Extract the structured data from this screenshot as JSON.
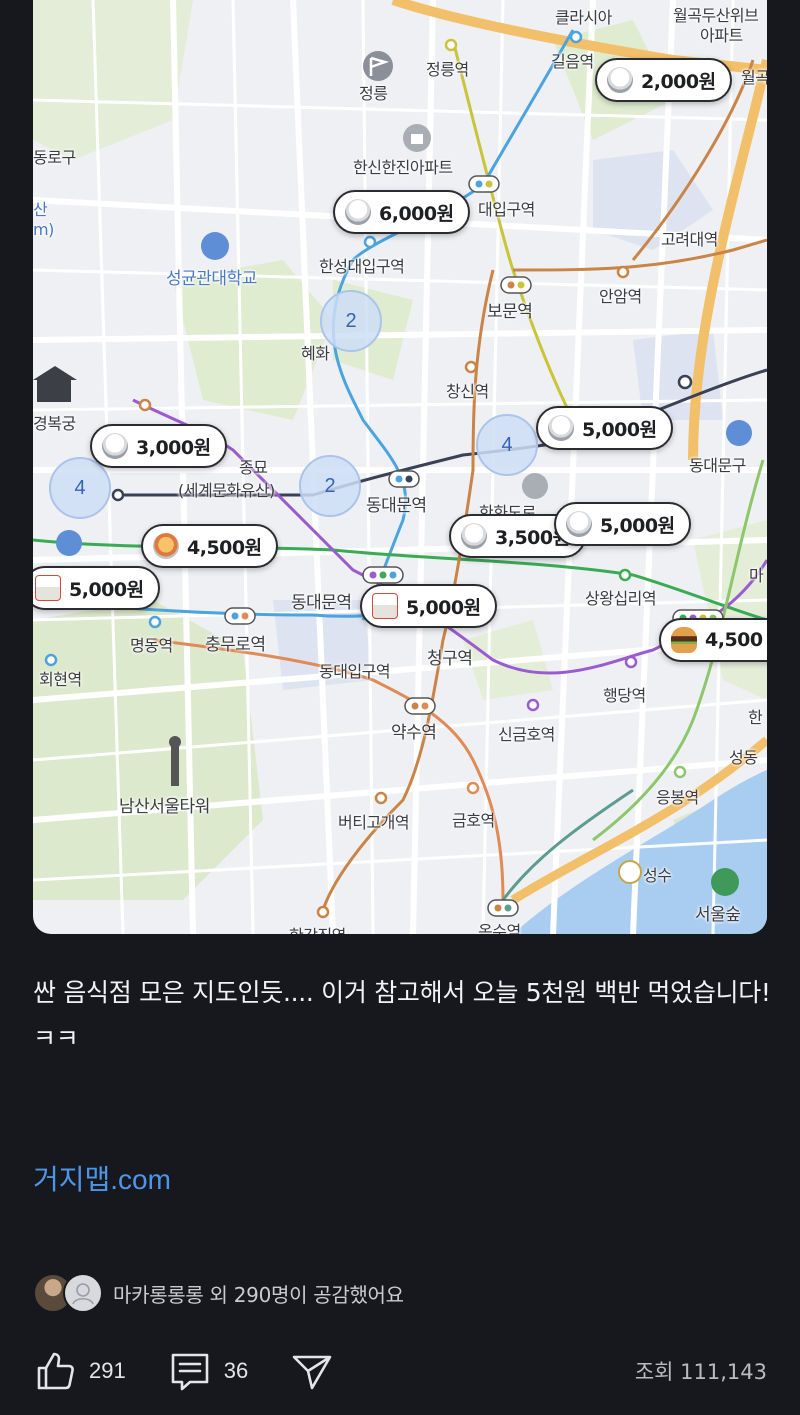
{
  "map": {
    "labels": [
      {
        "text": "클라시아",
        "cls": ""
      },
      {
        "text": "월곡두산위브",
        "cls": ""
      },
      {
        "text": "아파트",
        "cls": ""
      },
      {
        "text": "정릉역",
        "cls": ""
      },
      {
        "text": "길음역",
        "cls": ""
      },
      {
        "text": "월곡",
        "cls": ""
      },
      {
        "text": "정릉",
        "cls": ""
      },
      {
        "text": "동로구",
        "cls": ""
      },
      {
        "text": "한신한진아파트",
        "cls": ""
      },
      {
        "text": "대입구역",
        "cls": ""
      },
      {
        "text": "산",
        "cls": "blue"
      },
      {
        "text": "m)",
        "cls": "blue"
      },
      {
        "text": "고려대역",
        "cls": ""
      },
      {
        "text": "성균관대학교",
        "cls": "blue"
      },
      {
        "text": "한성대입구역",
        "cls": ""
      },
      {
        "text": "안암역",
        "cls": ""
      },
      {
        "text": "보문역",
        "cls": ""
      },
      {
        "text": "혜화",
        "cls": ""
      },
      {
        "text": "창신역",
        "cls": ""
      },
      {
        "text": "경복궁",
        "cls": ""
      },
      {
        "text": "동대문구",
        "cls": ""
      },
      {
        "text": "종묘",
        "cls": ""
      },
      {
        "text": "(세계문화유산)",
        "cls": ""
      },
      {
        "text": "동대문역",
        "cls": ""
      },
      {
        "text": "한화도로",
        "cls": ""
      },
      {
        "text": "마",
        "cls": ""
      },
      {
        "text": "상왕십리역",
        "cls": ""
      },
      {
        "text": "동대문역",
        "cls": ""
      },
      {
        "text": "명동역",
        "cls": ""
      },
      {
        "text": "충무로역",
        "cls": ""
      },
      {
        "text": "청구역",
        "cls": ""
      },
      {
        "text": "회현역",
        "cls": ""
      },
      {
        "text": "동대입구역",
        "cls": ""
      },
      {
        "text": "행당역",
        "cls": ""
      },
      {
        "text": "한",
        "cls": ""
      },
      {
        "text": "약수역",
        "cls": ""
      },
      {
        "text": "신금호역",
        "cls": ""
      },
      {
        "text": "성동",
        "cls": ""
      },
      {
        "text": "남산서울타워",
        "cls": ""
      },
      {
        "text": "응봉역",
        "cls": ""
      },
      {
        "text": "버티고개역",
        "cls": ""
      },
      {
        "text": "금호역",
        "cls": ""
      },
      {
        "text": "성수",
        "cls": ""
      },
      {
        "text": "서울숲",
        "cls": ""
      },
      {
        "text": "한강진역",
        "cls": ""
      },
      {
        "text": "옥수역",
        "cls": ""
      }
    ],
    "pins": [
      {
        "price": "2,000원",
        "icon": "rice-bowl-icon"
      },
      {
        "price": "6,000원",
        "icon": "rice-bowl-icon"
      },
      {
        "price": "3,000원",
        "icon": "rice-bowl-icon"
      },
      {
        "price": "5,000원",
        "icon": "rice-bowl-icon"
      },
      {
        "price": "4,500원",
        "icon": "noodle-bowl-icon"
      },
      {
        "price": "3,500원",
        "icon": "rice-bowl-icon"
      },
      {
        "price": "5,000원",
        "icon": "rice-bowl-icon"
      },
      {
        "price": "5,000원",
        "icon": "takeout-box-icon"
      },
      {
        "price": "5,000원",
        "icon": "takeout-box-icon"
      },
      {
        "price": "4,500",
        "icon": "burger-icon"
      }
    ],
    "clusters": [
      "2",
      "4",
      "2",
      "4"
    ]
  },
  "post": {
    "body": "싼 음식점 모은 지도인듯.... 이거 참고해서 오늘 5천원 백반 먹었습니다!ㅋㅋ",
    "link": "거지맵.com"
  },
  "reactions": {
    "summary": "마카롱롱롱 외 290명이 공감했어요"
  },
  "actions": {
    "likes": "291",
    "comments": "36",
    "views_label": "조회 111,143"
  },
  "colors": {
    "background": "#17181d",
    "link": "#4d95e8",
    "cluster": "#3563b4"
  }
}
